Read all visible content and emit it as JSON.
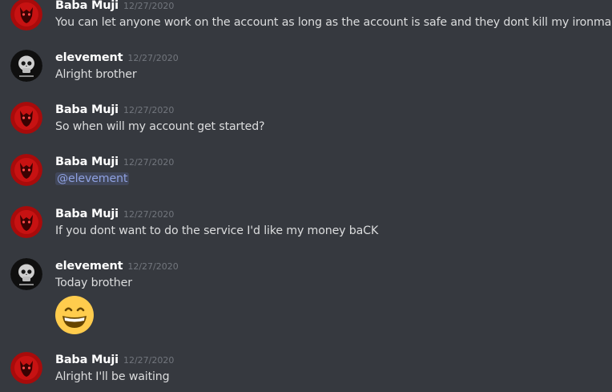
{
  "messages": [
    {
      "author": "Baba Muji",
      "timestamp": "12/27/2020",
      "text": "You can let anyone work on the account as long as the account is safe and they dont kill my ironman"
    },
    {
      "author": "elevement",
      "timestamp": "12/27/2020",
      "text": "Alright brother"
    },
    {
      "author": "Baba Muji",
      "timestamp": "12/27/2020",
      "text": "So when will my account get started?"
    },
    {
      "author": "Baba Muji",
      "timestamp": "12/27/2020",
      "mention": "@elevement"
    },
    {
      "author": "Baba Muji",
      "timestamp": "12/27/2020",
      "text": "If you dont want to do the service I'd like my money baCK"
    },
    {
      "author": "elevement",
      "timestamp": "12/27/2020",
      "text": "Today brother",
      "emoji": "grinning-face-emoji"
    },
    {
      "author": "Baba Muji",
      "timestamp": "12/27/2020",
      "text": "Alright I'll be waiting"
    }
  ],
  "colors": {
    "background": "#36393f",
    "username": "#ffffff",
    "timestamp": "#72767d",
    "message_text": "#dcddde",
    "mention_text": "#8ea1e1",
    "baba_avatar": "#b50d0d",
    "elevement_avatar": "#101010"
  },
  "icons": {
    "baba_avatar": "red-demon-avatar-icon",
    "elevement_avatar": "skull-avatar-icon"
  }
}
